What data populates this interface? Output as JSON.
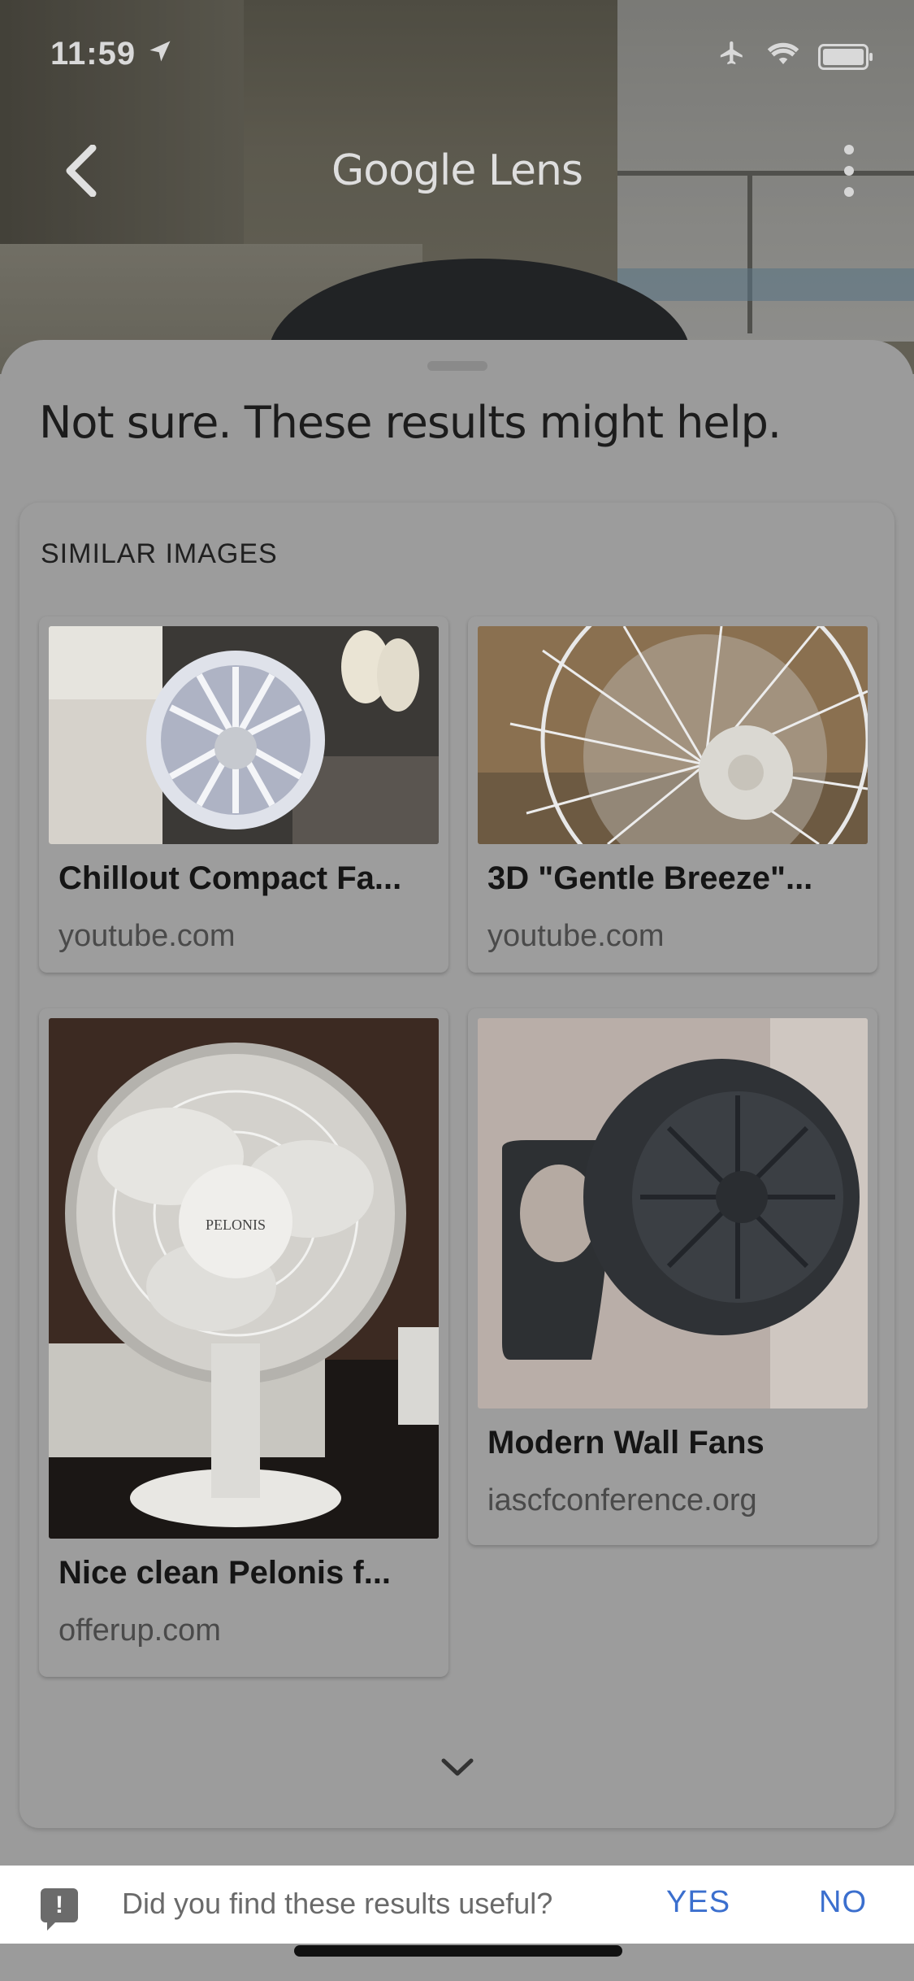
{
  "status_bar": {
    "time": "11:59",
    "location_icon": "location-arrow-icon",
    "airplane_icon": "airplane-icon",
    "wifi_icon": "wifi-icon",
    "battery_icon": "battery-icon"
  },
  "app_bar": {
    "title": "Google Lens",
    "back_icon": "chevron-left-icon",
    "more_icon": "more-vertical-icon"
  },
  "sheet": {
    "heading": "Not sure. These results might help.",
    "section_title": "SIMILAR IMAGES",
    "results": [
      {
        "title": "Chillout Compact Fa...",
        "source": "youtube.com"
      },
      {
        "title": "3D \"Gentle Breeze\"...",
        "source": "youtube.com"
      },
      {
        "title": "Nice clean Pelonis f...",
        "source": "offerup.com"
      },
      {
        "title": "Modern Wall Fans",
        "source": "iascfconference.org"
      }
    ],
    "expand_icon": "chevron-down-icon"
  },
  "feedback": {
    "question": "Did you find these results useful?",
    "yes_label": "YES",
    "no_label": "NO",
    "icon": "feedback-alert-icon"
  },
  "colors": {
    "accent": "#3b6fce"
  }
}
